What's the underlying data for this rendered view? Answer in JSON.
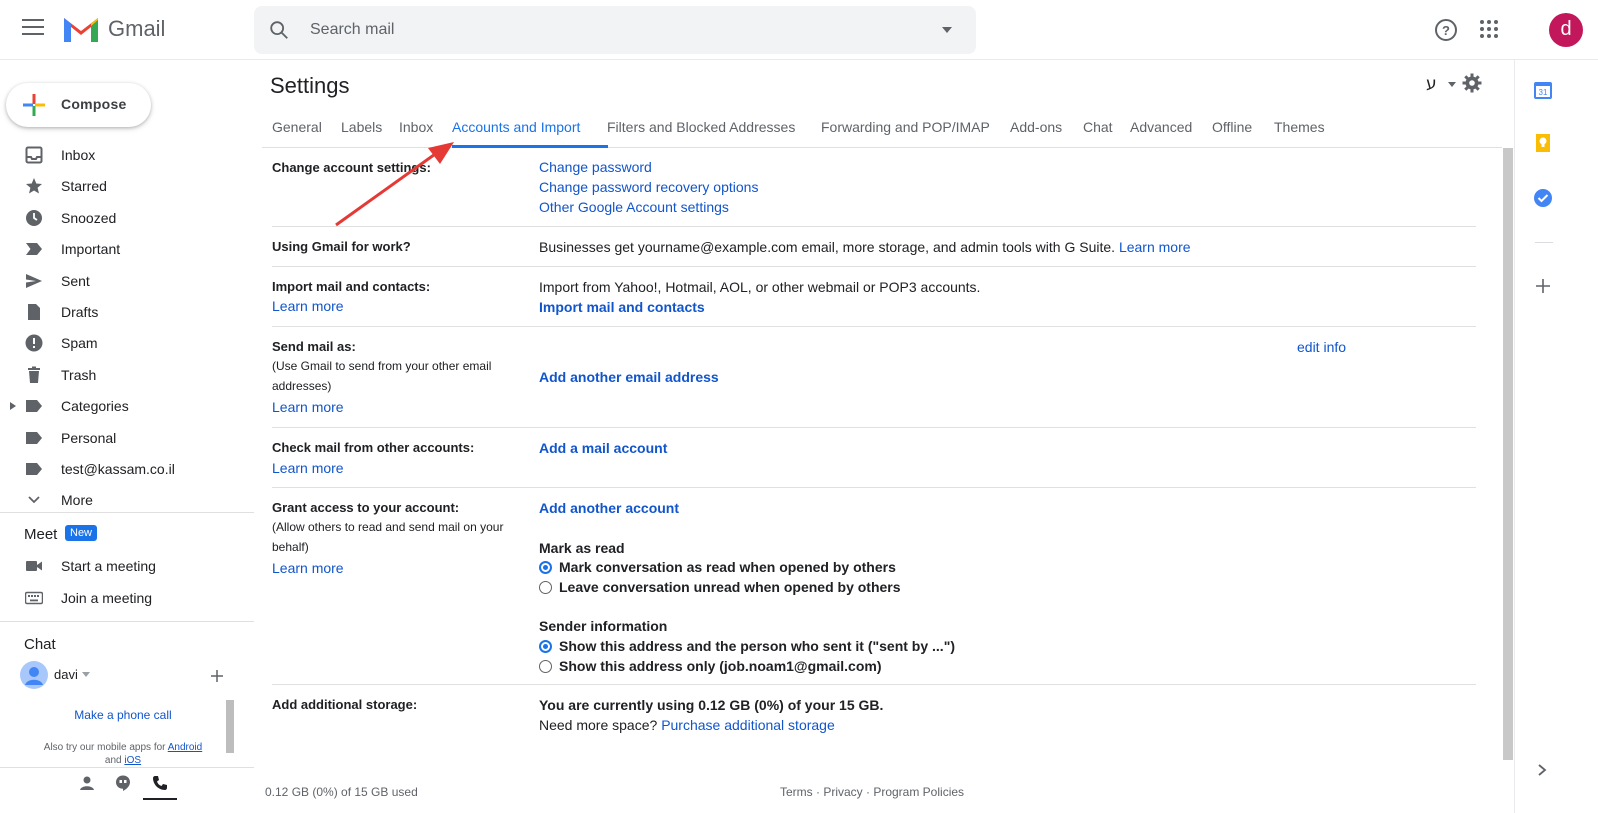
{
  "app": {
    "name": "Gmail",
    "avatar_initial": "d"
  },
  "search": {
    "placeholder": "Search mail"
  },
  "compose": {
    "label": "Compose"
  },
  "nav": [
    {
      "label": "Inbox",
      "icon": "inbox-icon"
    },
    {
      "label": "Starred",
      "icon": "star-icon"
    },
    {
      "label": "Snoozed",
      "icon": "clock-icon"
    },
    {
      "label": "Important",
      "icon": "important-icon"
    },
    {
      "label": "Sent",
      "icon": "send-icon"
    },
    {
      "label": "Drafts",
      "icon": "draft-icon"
    },
    {
      "label": "Spam",
      "icon": "spam-icon"
    },
    {
      "label": "Trash",
      "icon": "trash-icon"
    },
    {
      "label": "Categories",
      "icon": "label-icon"
    },
    {
      "label": "Personal",
      "icon": "label-icon"
    },
    {
      "label": "test@kassam.co.il",
      "icon": "label-icon"
    },
    {
      "label": "More",
      "icon": "chevron-down-icon"
    }
  ],
  "meet": {
    "title": "Meet",
    "badge": "New",
    "start": "Start a meeting",
    "join": "Join a meeting"
  },
  "chat": {
    "title": "Chat",
    "user": "davi",
    "phone_call": "Make a phone call",
    "mobile_text": "Also try our mobile apps for",
    "android": "Android",
    "and": "and",
    "ios": "iOS"
  },
  "settings": {
    "title": "Settings",
    "lang_glyph": "ע",
    "tabs": [
      "General",
      "Labels",
      "Inbox",
      "Accounts and Import",
      "Filters and Blocked Addresses",
      "Forwarding and POP/IMAP",
      "Add-ons",
      "Chat",
      "Advanced",
      "Offline",
      "Themes"
    ],
    "active_tab": "Accounts and Import",
    "change_account": {
      "label": "Change account settings:",
      "links": [
        "Change password",
        "Change password recovery options",
        "Other Google Account settings"
      ]
    },
    "gmail_work": {
      "label": "Using Gmail for work?",
      "text": "Businesses get yourname@example.com email, more storage, and admin tools with G Suite.",
      "link": "Learn more"
    },
    "import": {
      "label": "Import mail and contacts:",
      "learn": "Learn more",
      "text": "Import from Yahoo!, Hotmail, AOL, or other webmail or POP3 accounts.",
      "action": "Import mail and contacts"
    },
    "send_as": {
      "label": "Send mail as:",
      "sub": "(Use Gmail to send from your other email addresses)",
      "learn": "Learn more",
      "edit": "edit info",
      "action": "Add another email address"
    },
    "check_mail": {
      "label": "Check mail from other accounts:",
      "learn": "Learn more",
      "action": "Add a mail account"
    },
    "grant": {
      "label": "Grant access to your account:",
      "sub": "(Allow others to read and send mail on your behalf)",
      "learn": "Learn more",
      "action": "Add another account",
      "mark_title": "Mark as read",
      "mark_opts": [
        "Mark conversation as read when opened by others",
        "Leave conversation unread when opened by others"
      ],
      "sender_title": "Sender information",
      "sender_opts": [
        "Show this address and the person who sent it (\"sent by ...\")",
        "Show this address only (job.noam1@gmail.com)"
      ]
    },
    "storage": {
      "label": "Add additional storage:",
      "usage": "You are currently using 0.12 GB (0%) of your 15 GB.",
      "need": "Need more space?",
      "link": "Purchase additional storage"
    }
  },
  "footer": {
    "usage": "0.12 GB (0%) of 15 GB used",
    "links": "Terms · Privacy · Program Policies"
  },
  "colors": {
    "accent": "#1a73e8",
    "link": "#1155cc",
    "annotation_arrow": "#e53935"
  }
}
